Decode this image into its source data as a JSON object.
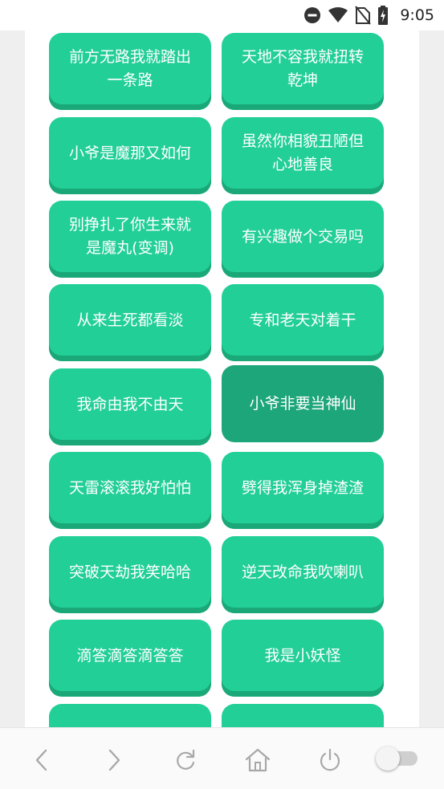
{
  "status_bar": {
    "time": "9:05",
    "icons": [
      "do-not-disturb-icon",
      "wifi-icon",
      "no-sim-icon",
      "battery-charging-icon"
    ]
  },
  "buttons": [
    {
      "label": "前方无路我就踏出一条路",
      "selected": false
    },
    {
      "label": "天地不容我就扭转乾坤",
      "selected": false
    },
    {
      "label": "小爷是魔那又如何",
      "selected": false
    },
    {
      "label": "虽然你相貌丑陋但心地善良",
      "selected": false
    },
    {
      "label": "别挣扎了你生来就是魔丸(变调)",
      "selected": false
    },
    {
      "label": "有兴趣做个交易吗",
      "selected": false
    },
    {
      "label": "从来生死都看淡",
      "selected": false
    },
    {
      "label": "专和老天对着干",
      "selected": false
    },
    {
      "label": "我命由我不由天",
      "selected": false
    },
    {
      "label": "小爷非要当神仙",
      "selected": true
    },
    {
      "label": "天雷滚滚我好怕怕",
      "selected": false
    },
    {
      "label": "劈得我浑身掉渣渣",
      "selected": false
    },
    {
      "label": "突破天劫我笑哈哈",
      "selected": false
    },
    {
      "label": "逆天改命我吹喇叭",
      "selected": false
    },
    {
      "label": "滴答滴答滴答答",
      "selected": false
    },
    {
      "label": "我是小妖怪",
      "selected": false
    },
    {
      "label": "",
      "selected": false
    },
    {
      "label": "",
      "selected": false
    }
  ],
  "colors": {
    "button": "#22cf96",
    "button_shadow": "#1ba878",
    "button_selected": "#1da679",
    "page_background": "#efefef"
  },
  "toolbar": {
    "items": [
      "back-icon",
      "forward-icon",
      "refresh-icon",
      "home-icon",
      "power-icon"
    ],
    "toggle_on": false
  }
}
